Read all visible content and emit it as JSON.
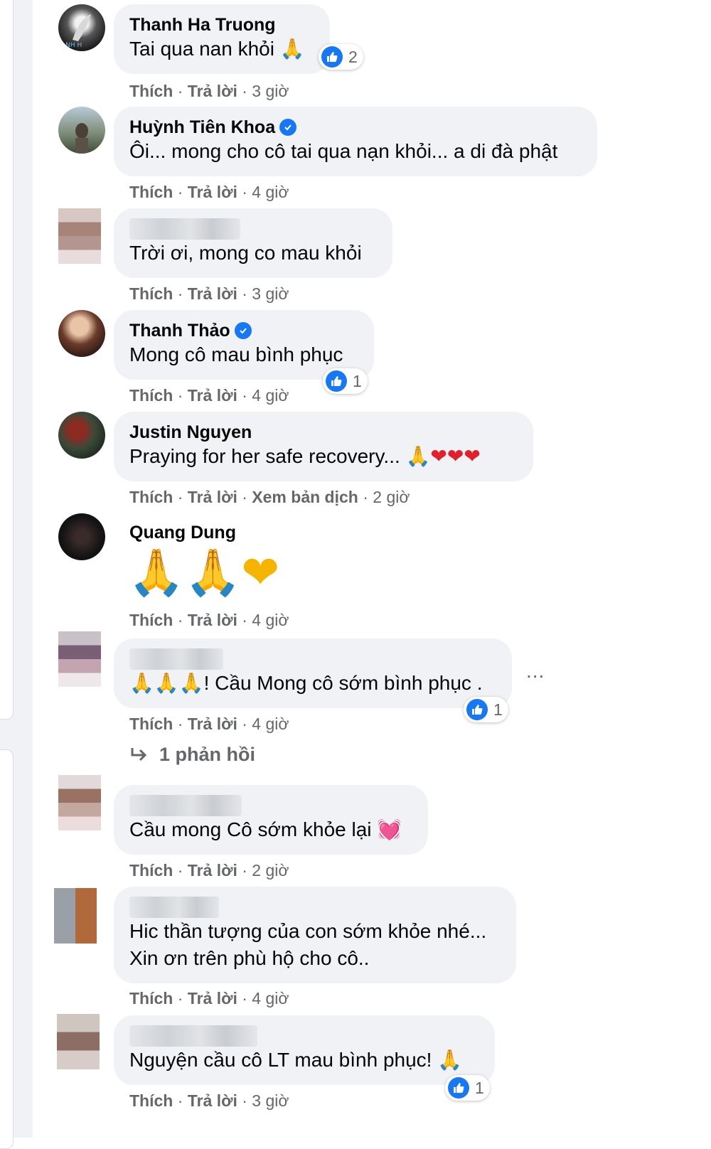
{
  "accent": "#1877f2",
  "comments": [
    {
      "author": "Thanh Ha Truong",
      "text": "Tai qua nan khỏi",
      "emoji": "🙏",
      "actions": {
        "like": "Thích",
        "reply": "Trả lời",
        "time": "3 giờ"
      },
      "reactions": "2"
    },
    {
      "author": "Huỳnh Tiên Khoa",
      "text": "Ôi... mong cho cô tai qua nạn khỏi... a di đà phật",
      "actions": {
        "like": "Thích",
        "reply": "Trả lời",
        "time": "4 giờ"
      }
    },
    {
      "author": "",
      "text": "Trời ơi, mong co mau khỏi",
      "actions": {
        "like": "Thích",
        "reply": "Trả lời",
        "time": "3 giờ"
      }
    },
    {
      "author": "Thanh Thảo",
      "text": "Mong cô mau bình phục",
      "actions": {
        "like": "Thích",
        "reply": "Trả lời",
        "time": "4 giờ"
      },
      "reactions": "1"
    },
    {
      "author": "Justin Nguyen",
      "text": "Praying for her safe recovery...",
      "emoji": "🙏❤❤❤",
      "actions": {
        "like": "Thích",
        "reply": "Trả lời",
        "translate": "Xem bản dịch",
        "time": "2 giờ"
      }
    },
    {
      "author": "Quang Dung",
      "emoji": "🙏🙏❤",
      "actions": {
        "like": "Thích",
        "reply": "Trả lời",
        "time": "4 giờ"
      }
    },
    {
      "author": "",
      "emoji": "🙏🙏🙏",
      "text": "! Cầu Mong cô sớm bình phục .",
      "actions": {
        "like": "Thích",
        "reply": "Trả lời",
        "time": "4 giờ"
      },
      "reactions": "1",
      "replies": "1 phản hồi"
    },
    {
      "author": "",
      "text": "Cầu mong Cô sớm khỏe lại",
      "emoji": "💓",
      "actions": {
        "like": "Thích",
        "reply": "Trả lời",
        "time": "2 giờ"
      }
    },
    {
      "author": "",
      "text_line1": "Hic thần tượng của con sớm khỏe nhé...",
      "text_line2": "Xin ơn trên phù hộ cho cô..",
      "actions": {
        "like": "Thích",
        "reply": "Trả lời",
        "time": "4 giờ"
      }
    },
    {
      "author": "",
      "text": "Nguyện cầu cô LT mau bình phục!",
      "emoji": "🙏",
      "actions": {
        "like": "Thích",
        "reply": "Trả lời",
        "time": "3 giờ"
      },
      "reactions": "1"
    }
  ],
  "more_options": "..."
}
